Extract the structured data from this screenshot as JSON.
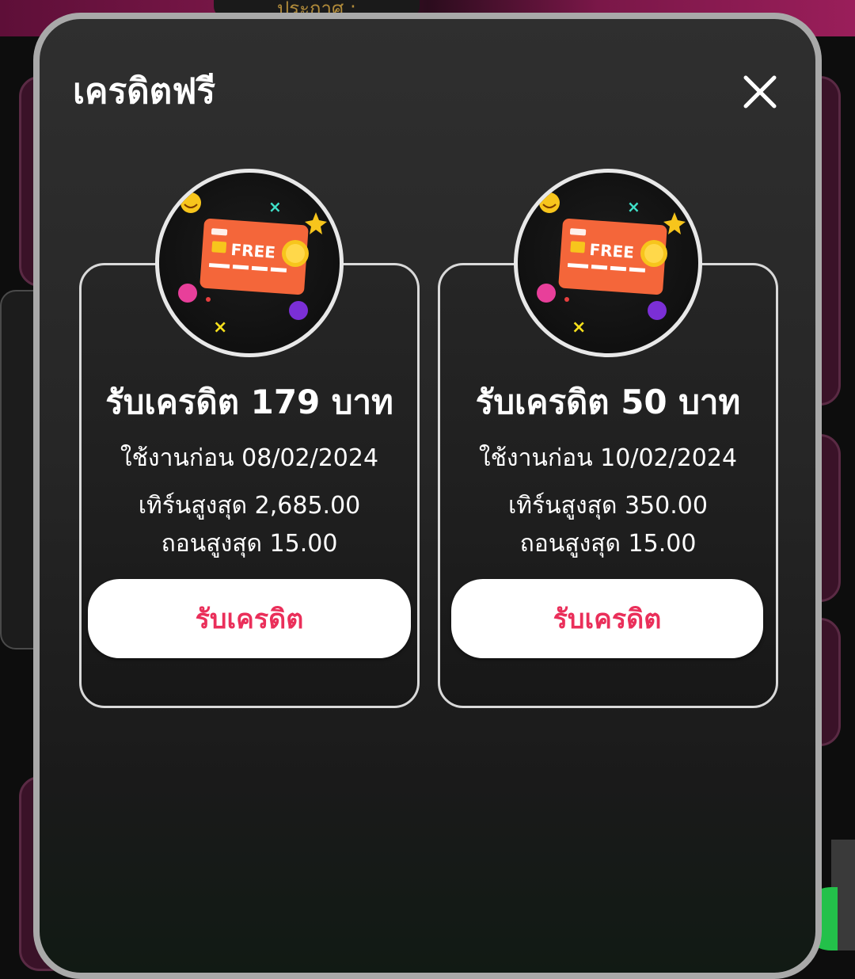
{
  "background": {
    "announcement": "ประกาศ :"
  },
  "modal": {
    "title": "เครดิตฟรี",
    "close_icon": "close-icon"
  },
  "cards": [
    {
      "badge_text": "FREE",
      "title": "รับเครดิต 179 บาท",
      "expire": "ใช้งานก่อน 08/02/2024",
      "turnover": "เทิร์นสูงสุด 2,685.00",
      "withdraw": "ถอนสูงสุด 15.00",
      "button_label": "รับเครดิต"
    },
    {
      "badge_text": "FREE",
      "title": "รับเครดิต 50 บาท",
      "expire": "ใช้งานก่อน 10/02/2024",
      "turnover": "เทิร์นสูงสุด 350.00",
      "withdraw": "ถอนสูงสุด 15.00",
      "button_label": "รับเครดิต"
    }
  ],
  "colors": {
    "accent": "#ea2f5a",
    "card_orange": "#f4663a",
    "coin": "#f7c51c"
  }
}
